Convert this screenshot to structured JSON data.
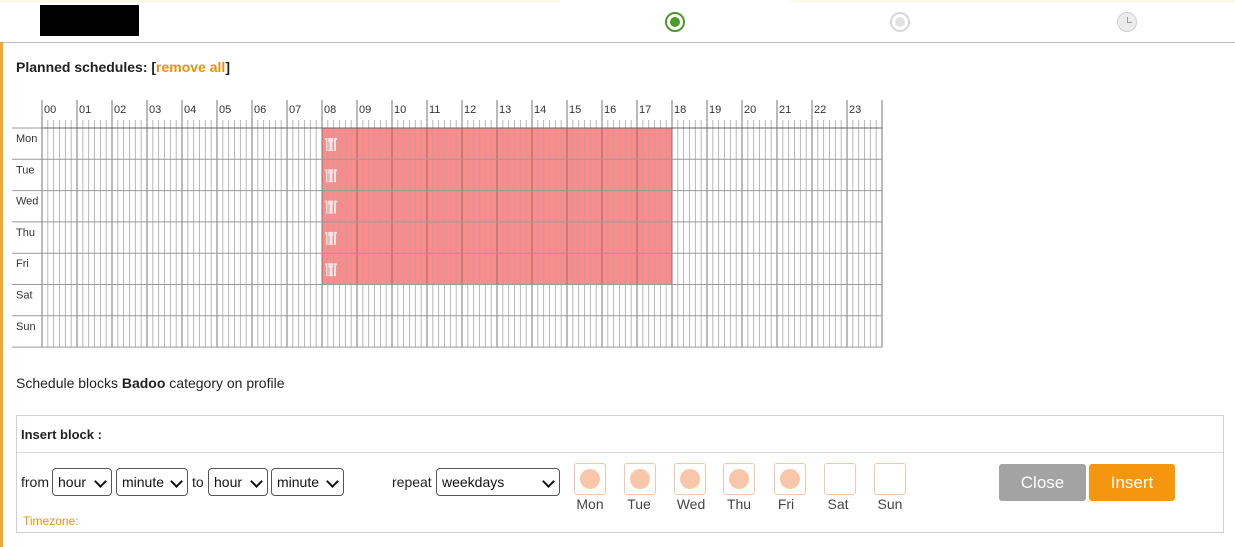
{
  "header": {
    "steps": [
      {
        "state": "active",
        "icon": "radio-active"
      },
      {
        "state": "inactive",
        "icon": "radio-inactive"
      },
      {
        "state": "inactive",
        "icon": "clock-icon"
      }
    ]
  },
  "planned": {
    "title": "Planned schedules: [",
    "remove_all": "remove all",
    "close_bracket": "]"
  },
  "schedule": {
    "hours": [
      "00",
      "01",
      "02",
      "03",
      "04",
      "05",
      "06",
      "07",
      "08",
      "09",
      "10",
      "11",
      "12",
      "13",
      "14",
      "15",
      "16",
      "17",
      "18",
      "19",
      "20",
      "21",
      "22",
      "23"
    ],
    "days": [
      "Mon",
      "Tue",
      "Wed",
      "Thu",
      "Fri",
      "Sat",
      "Sun"
    ],
    "blocks": [
      {
        "day": "Mon",
        "start": "08:00",
        "end": "18:00"
      },
      {
        "day": "Tue",
        "start": "08:00",
        "end": "18:00"
      },
      {
        "day": "Wed",
        "start": "08:00",
        "end": "18:00"
      },
      {
        "day": "Thu",
        "start": "08:00",
        "end": "18:00"
      },
      {
        "day": "Fri",
        "start": "08:00",
        "end": "18:00"
      }
    ],
    "block_color": "#ff8a8a",
    "delete_icon": "trash-icon"
  },
  "description": {
    "prefix": "Schedule blocks ",
    "category": "Badoo",
    "suffix": " category on profile"
  },
  "insert": {
    "title": "Insert block :",
    "from_label": "from",
    "from_hour": "hour",
    "from_minute": "minute",
    "to_label": "to",
    "to_hour": "hour",
    "to_minute": "minute",
    "repeat_label": "repeat",
    "repeat_value": "weekdays",
    "days": [
      {
        "label": "Mon",
        "checked": true
      },
      {
        "label": "Tue",
        "checked": true
      },
      {
        "label": "Wed",
        "checked": true
      },
      {
        "label": "Thu",
        "checked": true
      },
      {
        "label": "Fri",
        "checked": true
      },
      {
        "label": "Sat",
        "checked": false
      },
      {
        "label": "Sun",
        "checked": false
      }
    ],
    "close_label": "Close",
    "insert_label": "Insert",
    "timezone_label": "Timezone:"
  },
  "colors": {
    "accent": "#f5960f",
    "active_step": "#4c9a2a"
  }
}
